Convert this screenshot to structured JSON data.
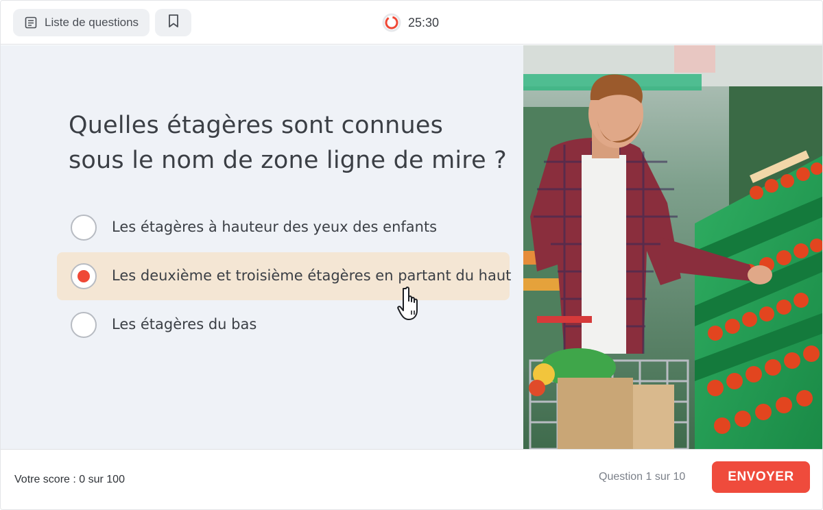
{
  "toolbar": {
    "question_list_label": "Liste de questions",
    "question_list_icon": "list-document-icon",
    "bookmark_icon": "bookmark-icon"
  },
  "timer": {
    "value": "25:30",
    "icon": "countdown-ring-icon",
    "accent_color": "#ef4836"
  },
  "question": {
    "line1": "Quelles étagères sont connues",
    "line2": "sous le nom de zone ligne de mire ?",
    "options": [
      {
        "label": "Les étagères à hauteur des yeux des enfants",
        "selected": false
      },
      {
        "label": "Les deuxième et troisième étagères en partant du haut",
        "selected": true
      },
      {
        "label": "Les étagères du bas",
        "selected": false
      }
    ]
  },
  "footer": {
    "score_text": "Votre score : 0 sur 100",
    "progress_text": "Question 1 sur 10",
    "submit_label": "ENVOYER"
  },
  "colors": {
    "accent": "#ef4b3c",
    "selected_option_bg": "#f4e6d4",
    "panel_bg": "#eff2f7"
  }
}
